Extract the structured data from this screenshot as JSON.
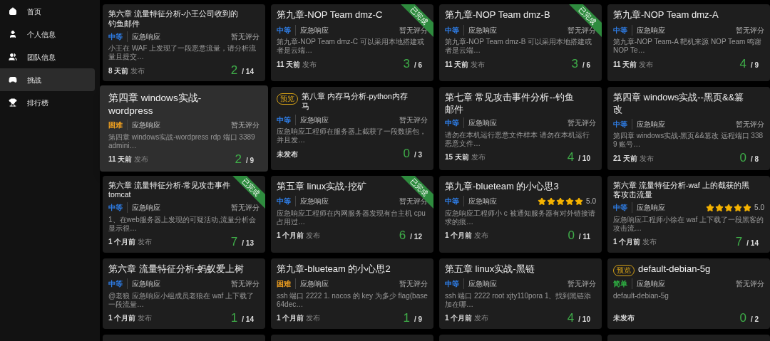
{
  "sidebar": {
    "items": [
      {
        "label": "首页",
        "selected": false
      },
      {
        "label": "个人信息",
        "selected": false
      },
      {
        "label": "团队信息",
        "selected": false
      },
      {
        "label": "挑战",
        "selected": true
      },
      {
        "label": "排行榜",
        "selected": false
      }
    ]
  },
  "challenges": [
    {
      "title": "第六章 流量特征分析-小王公司收到的钓鱼邮件",
      "difficulty": "中等",
      "color": "#2f80ed",
      "category": "应急响应",
      "rating": "暂无评分",
      "summary": "小王在 WAF 上发现了一段恶意流量，请分析流量且提交…",
      "time": "8 天前",
      "time_suffix": "发布",
      "solved": "2",
      "total": "/ 14"
    },
    {
      "title": "第九章-NOP Team dmz-C",
      "completed": true,
      "ribbon": "已完成",
      "difficulty": "中等",
      "color": "#2f80ed",
      "category": "应急响应",
      "rating": "暂无评分",
      "summary": "第九章-NOP Team dmz-C 可以采用本地搭建或者是云端…",
      "time": "11 天前",
      "time_suffix": "发布",
      "solved": "3",
      "total": "/ 6"
    },
    {
      "title": "第九章-NOP Team dmz-B",
      "completed": true,
      "ribbon": "已完成",
      "difficulty": "中等",
      "color": "#2f80ed",
      "category": "应急响应",
      "rating": "暂无评分",
      "summary": "第九章-NOP Team dmz-B 可以采用本地搭建或者是云端…",
      "time": "11 天前",
      "time_suffix": "发布",
      "solved": "3",
      "total": "/ 6"
    },
    {
      "title": "第九章-NOP Team dmz-A",
      "difficulty": "中等",
      "color": "#2f80ed",
      "category": "应急响应",
      "rating": "暂无评分",
      "summary": "第九章-NOP Team-A 靶机来源 NOP Team 鸣谢 NOP Te…",
      "time": "11 天前",
      "time_suffix": "发布",
      "solved": "4",
      "total": "/ 9"
    },
    {
      "title": "第四章 windows实战-wordpress",
      "hovered": true,
      "difficulty": "困难",
      "color": "#f0a020",
      "category": "应急响应",
      "rating": "暂无评分",
      "summary": "第四章 windows实战-wordpress rdp 端口 3389 admini…",
      "time": "11 天前",
      "time_suffix": "发布",
      "solved": "2",
      "total": "/ 9"
    },
    {
      "title": "第八章 内存马分析-python内存马",
      "preview": "预览",
      "difficulty": "中等",
      "color": "#2f80ed",
      "category": "应急响应",
      "rating": "暂无评分",
      "summary": "应急响应工程师在服务器上截获了一段数据包，并且发…",
      "time": "未发布",
      "solved": "0",
      "total": "/ 3"
    },
    {
      "title": "第七章 常见攻击事件分析--钓鱼邮件",
      "difficulty": "中等",
      "color": "#2f80ed",
      "category": "应急响应",
      "rating": "暂无评分",
      "summary": "请勿在本机运行恶意文件样本 请勿在本机运行恶意文件…",
      "time": "15 天前",
      "time_suffix": "发布",
      "solved": "4",
      "total": "/ 10"
    },
    {
      "title": "第四章 windows实战--黑页&&篡改",
      "difficulty": "中等",
      "color": "#2f80ed",
      "category": "应急响应",
      "rating": "暂无评分",
      "summary": "第四章 windows实战-黑页&&篡改 远程端口 3389 账号…",
      "time": "21 天前",
      "time_suffix": "发布",
      "solved": "0",
      "total": "/ 8"
    },
    {
      "title": "第六章 流量特征分析-常见攻击事件 tomcat",
      "completed": true,
      "ribbon": "已完成",
      "difficulty": "中等",
      "color": "#2f80ed",
      "category": "应急响应",
      "rating": "暂无评分",
      "summary": "1、在web服务器上发现的可疑活动,流量分析会显示很…",
      "time": "1 个月前",
      "time_suffix": "发布",
      "solved": "7",
      "total": "/ 13"
    },
    {
      "title": "第五章 linux实战-挖矿",
      "completed": true,
      "ribbon": "已完成",
      "difficulty": "中等",
      "color": "#2f80ed",
      "category": "应急响应",
      "rating": "暂无评分",
      "summary": "应急响应工程师在内网服务器发现有台主机 cpu 占用过…",
      "time": "1 个月前",
      "time_suffix": "发布",
      "solved": "6",
      "total": "/ 12"
    },
    {
      "title": "第九章-blueteam 的小心思3",
      "difficulty": "中等",
      "color": "#2f80ed",
      "category": "应急响应",
      "stars": 5,
      "rating": "5.0",
      "summary": "应急响应工程师小 c 被通知服务器有对外链接请求的痕…",
      "time": "1 个月前",
      "time_suffix": "发布",
      "solved": "0",
      "total": "/ 11"
    },
    {
      "title": "第六章 流量特征分析-waf 上的截获的黑客攻击流量",
      "difficulty": "中等",
      "color": "#2f80ed",
      "category": "应急响应",
      "stars": 5,
      "rating": "5.0",
      "summary": "应急响应工程师小徐在 waf 上下载了一段黑客的攻击流…",
      "time": "1 个月前",
      "time_suffix": "发布",
      "solved": "7",
      "total": "/ 14"
    },
    {
      "title": "第六章 流量特征分析-蚂蚁爱上树",
      "difficulty": "中等",
      "color": "#2f80ed",
      "category": "应急响应",
      "rating": "暂无评分",
      "summary": "@老狼 应急响应小组成员老狼在 waf 上下载了一段流量…",
      "time": "1 个月前",
      "time_suffix": "发布",
      "solved": "1",
      "total": "/ 14"
    },
    {
      "title": "第九章-blueteam 的小心思2",
      "difficulty": "困难",
      "color": "#f0a020",
      "category": "应急响应",
      "rating": "暂无评分",
      "summary": "ssh 端口 2222 1. nacos 的 key 为多少 flag(base64dec…",
      "time": "1 个月前",
      "time_suffix": "发布",
      "solved": "1",
      "total": "/ 9"
    },
    {
      "title": "第五章 linux实战-黑链",
      "difficulty": "中等",
      "color": "#2f80ed",
      "category": "应急响应",
      "rating": "暂无评分",
      "summary": "ssh 端口 2222 root xjty110pora 1、找到黑链添加在哪…",
      "time": "1 个月前",
      "time_suffix": "发布",
      "solved": "4",
      "total": "/ 10"
    },
    {
      "title": "default-debian-5g",
      "preview": "预览",
      "difficulty": "简单",
      "color": "#2fb344",
      "category": "应急响应",
      "rating": "暂无评分",
      "summary": "default-debian-5g",
      "time": "未发布",
      "solved": "0",
      "total": "/ 2"
    }
  ]
}
